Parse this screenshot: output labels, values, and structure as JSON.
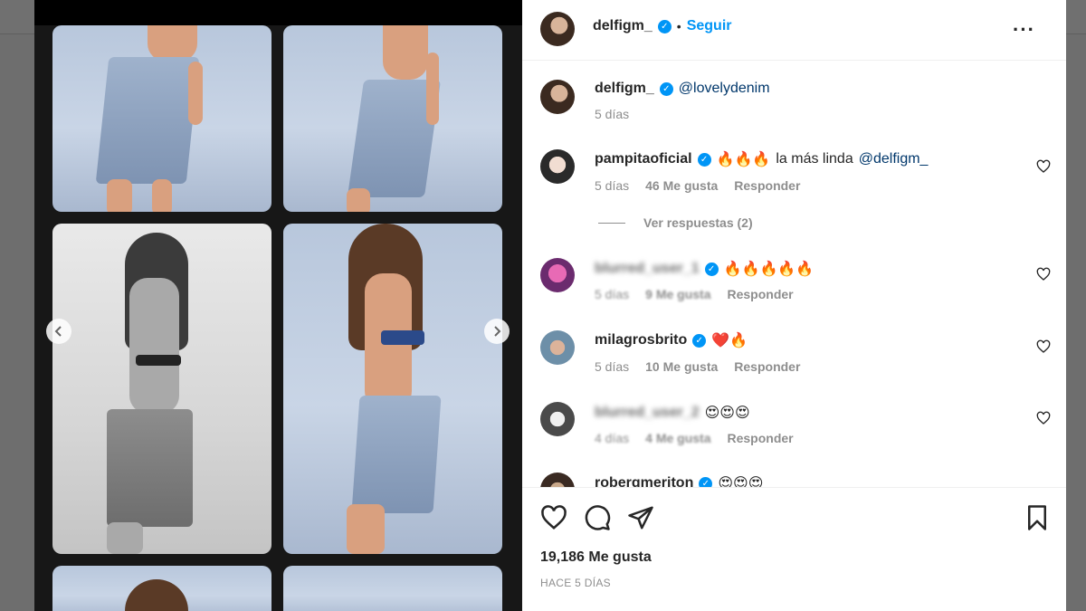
{
  "post": {
    "username": "delfigm_",
    "follow_label": "Seguir",
    "caption_user": "delfigm_",
    "caption_text": "@lovelydenim",
    "caption_time": "5 días",
    "likes": "19,186 Me gusta",
    "time_ago": "HACE 5 DÍAS"
  },
  "comments": [
    {
      "user": "pampitaoficial",
      "emoji": "🔥🔥🔥",
      "text": "la más linda",
      "mention": "@delfigm_",
      "time": "5 días",
      "likes": "46 Me gusta",
      "reply": "Responder",
      "view_replies": "Ver respuestas (2)"
    },
    {
      "user": "blurred_user_1",
      "emoji": "🔥🔥🔥🔥🔥",
      "time": "5 días",
      "likes": "9 Me gusta",
      "reply": "Responder"
    },
    {
      "user": "milagrosbrito",
      "emoji": "❤️🔥",
      "time": "5 días",
      "likes": "10 Me gusta",
      "reply": "Responder"
    },
    {
      "user": "blurred_user_2",
      "emoji": "😍😍😍",
      "time": "4 días",
      "likes": "4 Me gusta",
      "reply": "Responder"
    },
    {
      "user": "robergmeriton",
      "emoji": "😍😍😍"
    }
  ],
  "icons": {
    "like": "heart-icon",
    "comment": "comment-icon",
    "share": "send-icon",
    "save": "bookmark-icon",
    "more": "more-options-icon",
    "prev": "chevron-left-icon",
    "next": "chevron-right-icon"
  },
  "colors": {
    "accent": "#0095f6",
    "text": "#262626",
    "muted": "#8e8e8e"
  }
}
